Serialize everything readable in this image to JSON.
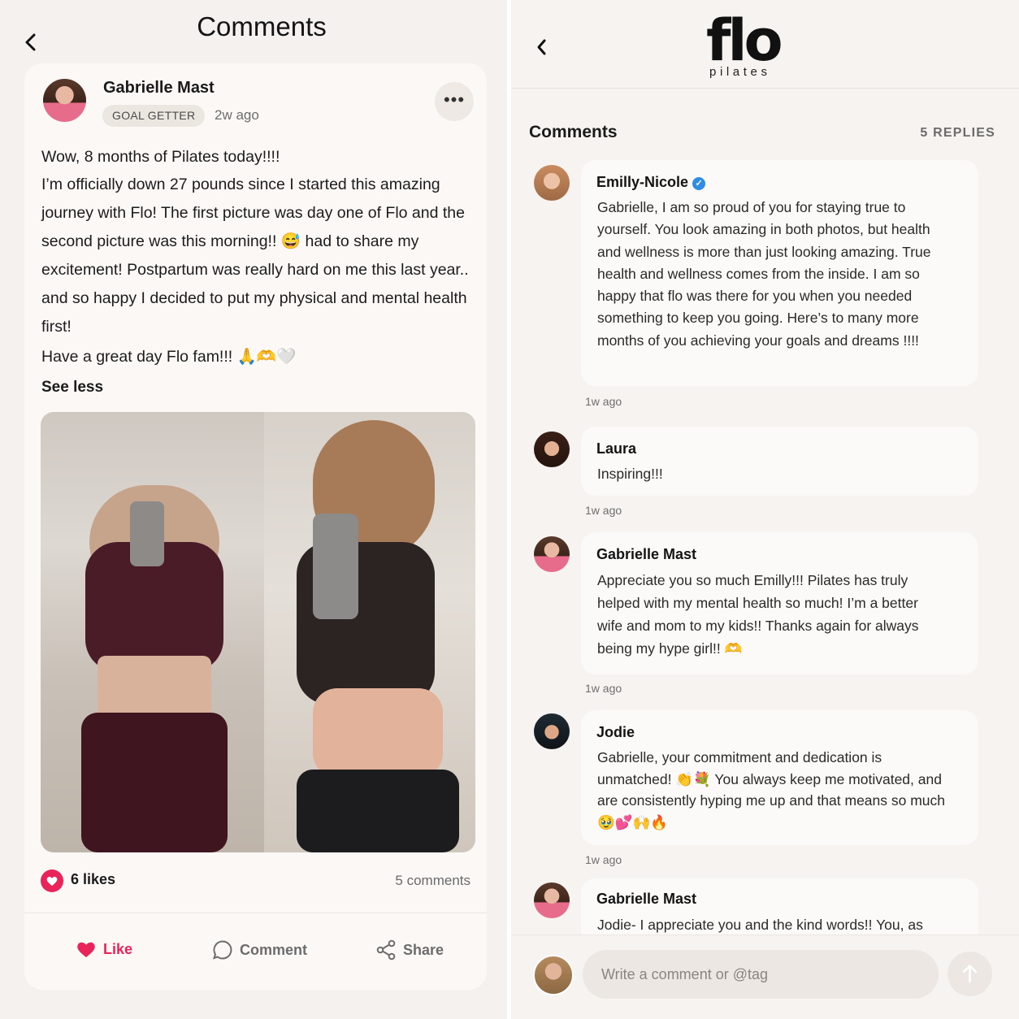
{
  "left": {
    "title": "Comments",
    "post": {
      "author": "Gabrielle Mast",
      "badge": "GOAL GETTER",
      "time": "2w ago",
      "more": "•••",
      "lines": [
        "Wow, 8 months of Pilates today!!!!",
        "I’m officially down 27 pounds since I started this amazing journey with Flo! The first picture was day one of Flo and the second picture was this morning!!  😅 had to share my excitement!  Postpartum was really hard on me this last year.. and so happy I decided to put my physical and mental health first!",
        "Have a great day Flo fam!!! 🙏🫶🤍"
      ],
      "see_less": "See less",
      "likes": "6 likes",
      "comments": "5 comments",
      "actions": {
        "like": "Like",
        "comment": "Comment",
        "share": "Share"
      }
    }
  },
  "right": {
    "logo": "flo",
    "logo_sub": "pilates",
    "heading": "Comments",
    "replies": "5 REPLIES",
    "comments": [
      {
        "name": "Emilly-Nicole",
        "verified": true,
        "text": "Gabrielle, I am so proud of you for staying true to yourself. You look amazing in both photos, but health and wellness is more than just looking amazing. True health and wellness comes from the inside. I am so happy that flo was there for you when you needed something to keep you going. Here’s to many more months of you achieving your goals and dreams !!!!",
        "time": "1w ago"
      },
      {
        "name": "Laura",
        "text": "Inspiring!!!",
        "time": "1w ago"
      },
      {
        "name": "Gabrielle Mast",
        "text": "Appreciate you so much Emilly!!! Pilates has truly helped with my mental health so much! I’m a better wife and mom to my kids!! Thanks again for always being my hype girl!! 🫶",
        "time": "1w ago"
      },
      {
        "name": "Jodie",
        "text": "Gabrielle, your commitment and dedication is unmatched! 👏💐 You always keep me motivated, and are consistently hyping me up and that means so much 🥹💕🙌🔥",
        "time": "1w ago"
      },
      {
        "name": "Gabrielle Mast",
        "text": "Jodie- I appreciate you and the kind words!! You, as"
      }
    ],
    "composer": {
      "placeholder": "Write a comment or @tag"
    }
  },
  "colors": {
    "like_red": "#e8245a",
    "verified_blue": "#2f8de6"
  },
  "icons": [
    "chevron-left-icon",
    "more-icon",
    "heart-icon",
    "comment-icon",
    "share-icon",
    "verified-icon",
    "send-arrow-icon"
  ]
}
